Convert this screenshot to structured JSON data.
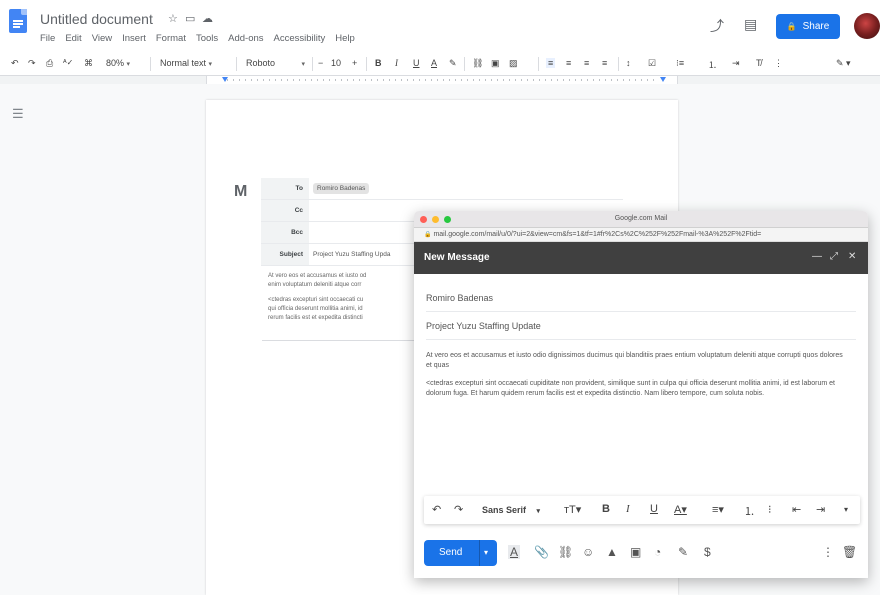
{
  "doc": {
    "title": "Untitled document",
    "menus": [
      "File",
      "Edit",
      "View",
      "Insert",
      "Format",
      "Tools",
      "Add-ons",
      "Accessibility",
      "Help"
    ],
    "share_label": "Share",
    "toolbar": {
      "zoom": "80%",
      "style": "Normal text",
      "font": "Roboto",
      "font_size": "10"
    },
    "email_table": {
      "to_label": "To",
      "to_value": "Romiro Badenas",
      "cc_label": "Cc",
      "bcc_label": "Bcc",
      "subject_label": "Subject",
      "subject_value": "Project Yuzu Staffing Upda"
    },
    "body_lines": [
      "At vero eos et accusamus et iusto od",
      "enim voluptatum deleniti atque corr",
      "",
      "<ctedras excepturi sint occaecati cu",
      "qui officia deserunt mollitia animi, id",
      "rerum facilis est et expedita distincti"
    ]
  },
  "gmail": {
    "window_title": "Google.com Mail",
    "url": "mail.google.com/mail/u/0/?ui=2&view=cm&fs=1&tf=1#fr%2Cs%2C%252F%252Fmail-%3A%252F%2Ftid=",
    "header_title": "New Message",
    "to": "Romiro Badenas",
    "subject": "Project Yuzu Staffing Update",
    "body_p1": "At vero eos et accusamus et iusto odio dignissimos ducimus qui blanditiis praes entium voluptatum deleniti atque corrupti quos dolores et quas",
    "body_p2": "<ctedras excepturi sint occaecati cupiditate non provident, similique sunt in culpa qui officia deserunt mollitia animi, id est laborum et dolorum fuga. Et harum quidem rerum facilis est et expedita distinctio. Nam libero tempore, cum soluta nobis.",
    "font_label": "Sans Serif",
    "send_label": "Send"
  },
  "icons": {
    "undo": "↶",
    "redo": "↷",
    "print": "⎙",
    "spell": "ᴬ✓",
    "paint": "⌘",
    "star": "☆",
    "folder": "▭",
    "cloud": "☁",
    "trend": "⤴",
    "comment": "▤",
    "lock": "🔒",
    "outline": "☰",
    "min": "—",
    "expand": "⤢",
    "close": "✕"
  }
}
